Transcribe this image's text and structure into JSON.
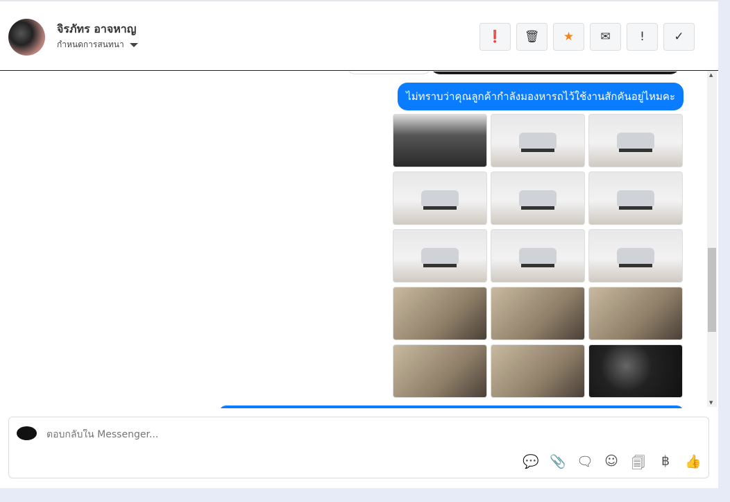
{
  "header": {
    "contact_name": "จิรภัทร อาจหาญ",
    "subtitle": "กำหนดการสนทนา",
    "actions": [
      {
        "name": "report-icon",
        "glyph": "❗"
      },
      {
        "name": "trash-icon",
        "glyph": "🗑"
      },
      {
        "name": "star-icon",
        "glyph": "★"
      },
      {
        "name": "mark-unread-icon",
        "glyph": "✉"
      },
      {
        "name": "follow-up-icon",
        "glyph": "!"
      },
      {
        "name": "done-icon",
        "glyph": "✓"
      }
    ]
  },
  "thread": {
    "message": "ไม่ทราบว่าคุณลูกค้ากำลังมองหารถไว้ใช้งานสักคันอยู่ไหมคะ",
    "photos": [
      "eng",
      "ext",
      "ext",
      "ext",
      "ext",
      "ext",
      "ext",
      "ext",
      "ext",
      "int",
      "int",
      "int",
      "int",
      "int",
      "dash"
    ]
  },
  "composer": {
    "placeholder": "ตอบกลับใน Messenger...",
    "tools": [
      {
        "name": "saved-reply-icon",
        "glyph": "💬"
      },
      {
        "name": "attach-icon",
        "glyph": "📎"
      },
      {
        "name": "quick-reply-icon",
        "glyph": "🗨"
      },
      {
        "name": "emoji-icon",
        "glyph": "☺"
      },
      {
        "name": "template-icon",
        "glyph": "🗐"
      },
      {
        "name": "payment-icon",
        "glyph": "฿"
      },
      {
        "name": "like-icon",
        "glyph": "👍"
      }
    ]
  },
  "colors": {
    "accent": "#0a7cff",
    "star": "#f5841f"
  }
}
